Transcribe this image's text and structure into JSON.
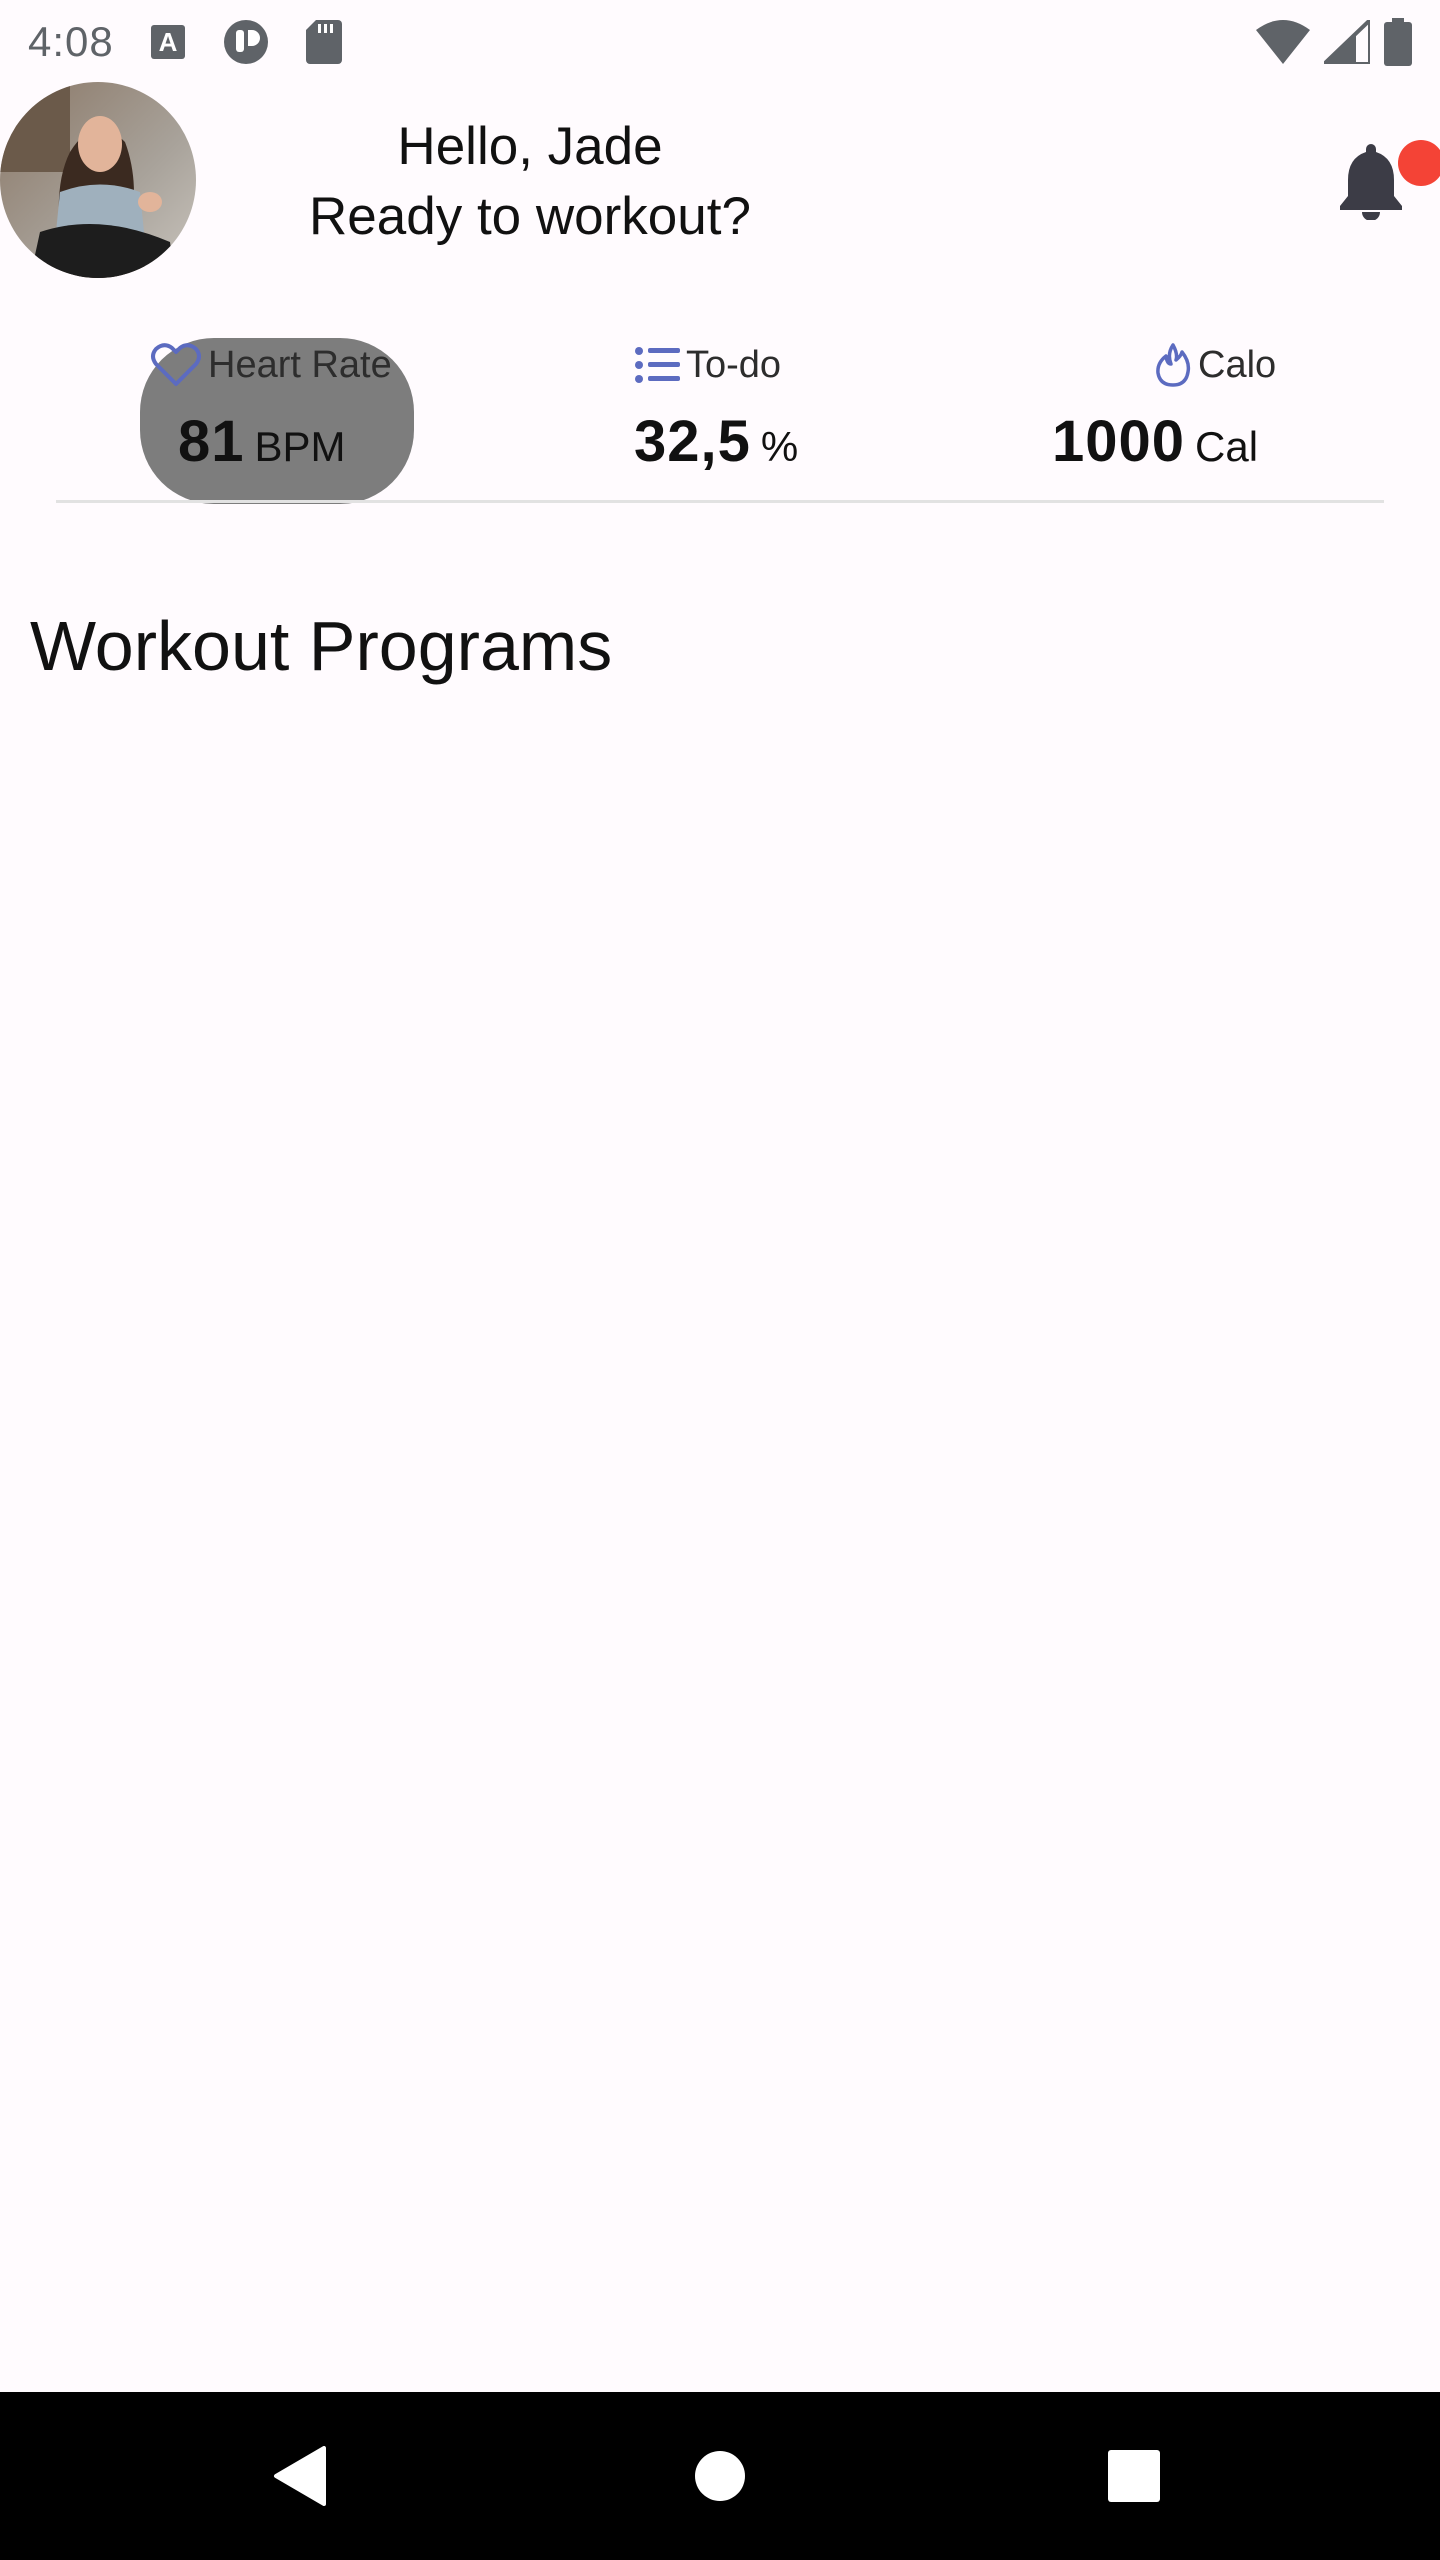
{
  "status_bar": {
    "time": "4:08",
    "notification_icons": [
      "font-a-icon",
      "app-pocket-icon",
      "sd-card-icon"
    ],
    "system_icons": [
      "wifi-icon",
      "signal-icon",
      "battery-icon"
    ]
  },
  "header": {
    "avatar_alt": "profile-photo",
    "greeting_line1": "Hello, Jade",
    "greeting_line2": "Ready to workout?",
    "notification_badge_color": "#f44336"
  },
  "stats": [
    {
      "icon": "heart-icon",
      "label": "Heart Rate",
      "value": "81",
      "unit": "BPM"
    },
    {
      "icon": "checklist-icon",
      "label": "To-do",
      "value": "32,5",
      "unit": "%"
    },
    {
      "icon": "flame-icon",
      "label": "Calo",
      "value": "1000",
      "unit": "Cal"
    }
  ],
  "section": {
    "title": "Workout Programs"
  },
  "colors": {
    "accent_icon": "#5c6bc0",
    "background": "#fffbfe",
    "highlight": "#7d7d7d"
  },
  "nav": {
    "buttons": [
      "back-icon",
      "home-icon",
      "recents-icon"
    ]
  }
}
